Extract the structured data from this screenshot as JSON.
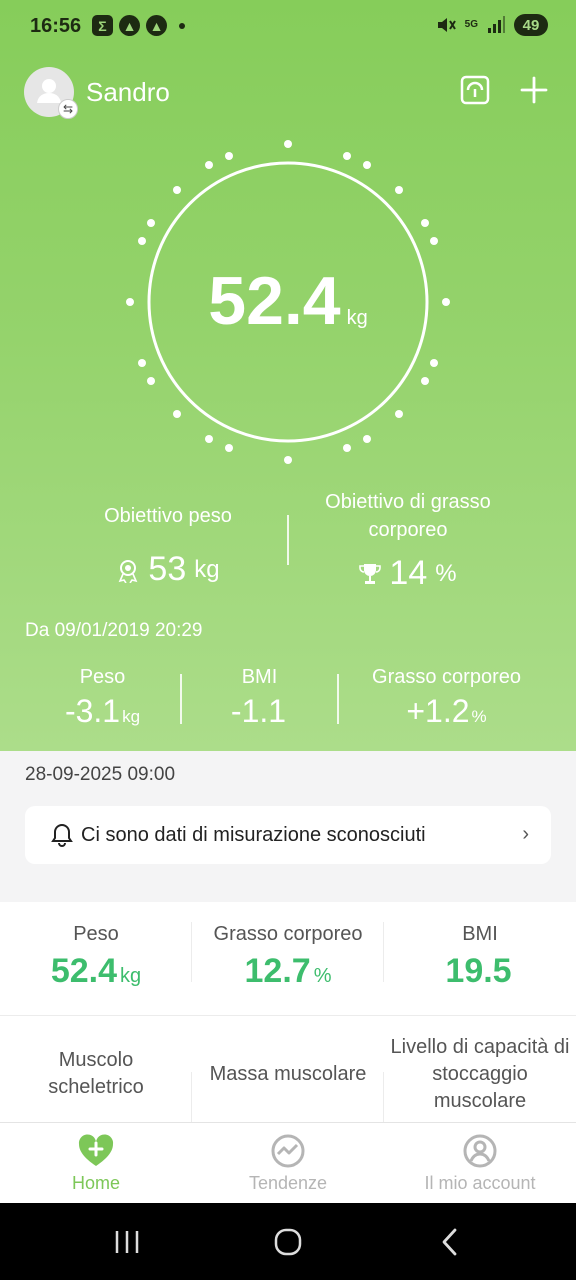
{
  "status_bar": {
    "time": "16:56",
    "app_icons": [
      "Σ",
      "▲",
      "▲"
    ],
    "network": "5G",
    "battery": "49"
  },
  "header": {
    "username": "Sandro",
    "avatar_icon": "user-avatar-icon",
    "actions": [
      "scale-sync-icon",
      "plus-icon"
    ]
  },
  "weight": {
    "value": "52.4",
    "unit": "kg"
  },
  "goals": {
    "weight": {
      "label": "Obiettivo peso",
      "value": "53",
      "unit": "kg",
      "icon": "medal-icon"
    },
    "body_fat": {
      "label": "Obiettivo di grasso corporeo",
      "value": "14",
      "unit": "%",
      "icon": "trophy-icon"
    }
  },
  "since": "Da 09/01/2019 20:29",
  "deltas": [
    {
      "label": "Peso",
      "value": "-3.1",
      "unit": "kg"
    },
    {
      "label": "BMI",
      "value": "-1.1",
      "unit": ""
    },
    {
      "label": "Grasso corporeo",
      "value": "+1.2",
      "unit": "%"
    }
  ],
  "measurement_date": "28-09-2025 09:00",
  "banner": {
    "text": "Ci sono dati di misurazione sconosciuti",
    "chevron": "›"
  },
  "metrics": [
    {
      "label": "Peso",
      "value": "52.4",
      "unit": "kg"
    },
    {
      "label": "Grasso corporeo",
      "value": "12.7",
      "unit": "%"
    },
    {
      "label": "BMI",
      "value": "19.5",
      "unit": ""
    },
    {
      "label": "Muscolo scheletrico",
      "value": "",
      "unit": ""
    },
    {
      "label": "Massa muscolare",
      "value": "",
      "unit": ""
    },
    {
      "label": "Livello di capacità di stoccaggio muscolare",
      "value": "",
      "unit": ""
    }
  ],
  "bottom_nav": [
    {
      "label": "Home",
      "icon": "heart-plus-icon",
      "active": true
    },
    {
      "label": "Tendenze",
      "icon": "trend-icon",
      "active": false
    },
    {
      "label": "Il mio account",
      "icon": "account-icon",
      "active": false
    }
  ],
  "colors": {
    "hero_green": "#86cd5a",
    "metric_green": "#3dbd6d",
    "nav_active": "#7dc758"
  }
}
